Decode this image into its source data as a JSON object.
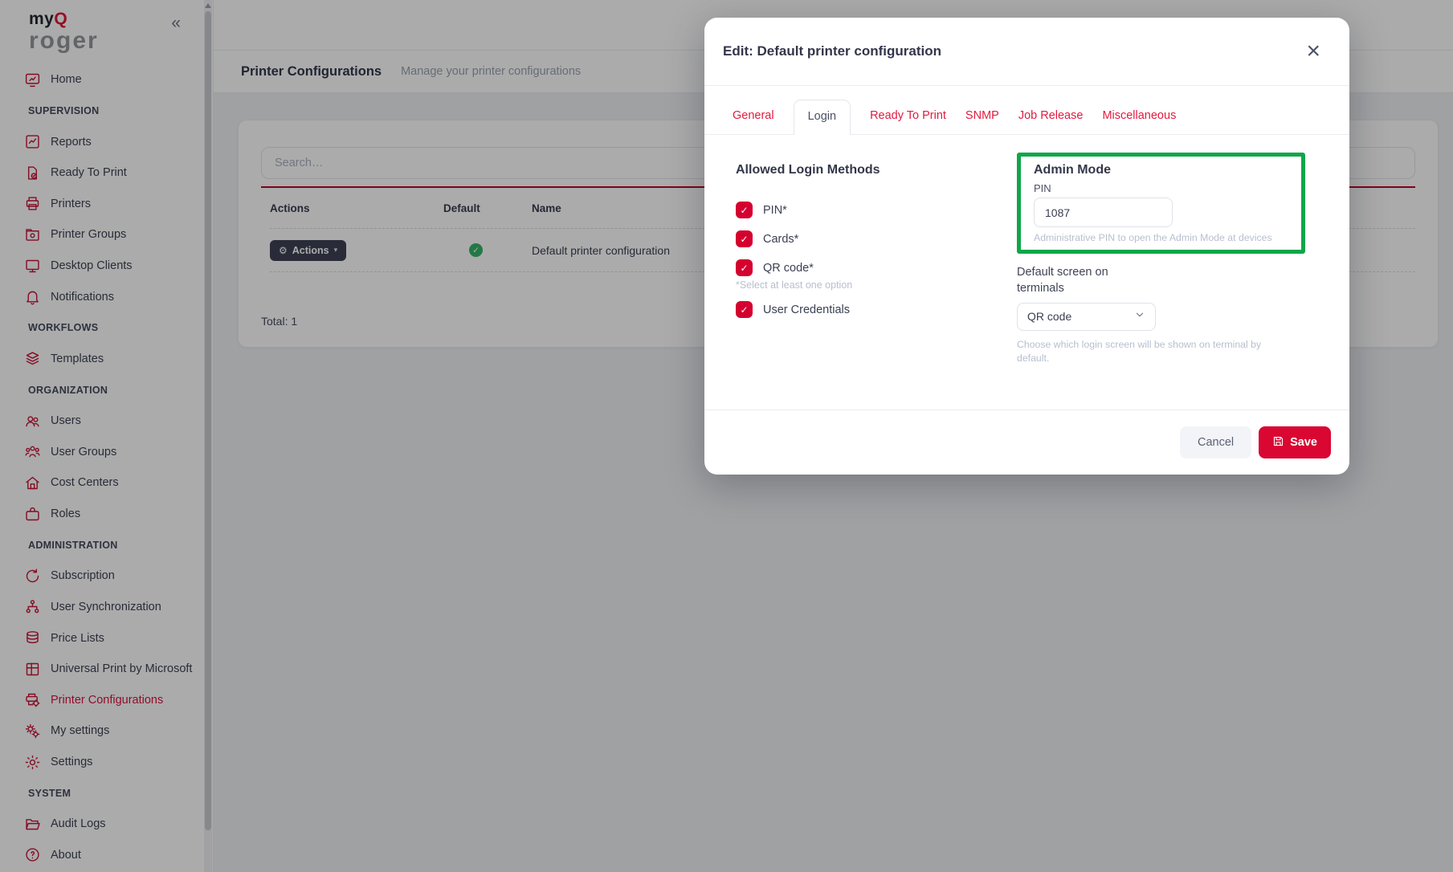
{
  "sidebar": {
    "logo_my": "my",
    "logo_q": "Q",
    "logo_roger": "roger",
    "collapse_icon": "«",
    "sections": [
      {
        "items": [
          {
            "label": "Home",
            "icon": "home"
          }
        ]
      },
      {
        "header": "SUPERVISION",
        "items": [
          {
            "label": "Reports",
            "icon": "reports"
          },
          {
            "label": "Ready To Print",
            "icon": "ready-to-print"
          },
          {
            "label": "Printers",
            "icon": "printers"
          },
          {
            "label": "Printer Groups",
            "icon": "printer-groups"
          },
          {
            "label": "Desktop Clients",
            "icon": "desktop-clients"
          },
          {
            "label": "Notifications",
            "icon": "notifications"
          }
        ]
      },
      {
        "header": "WORKFLOWS",
        "items": [
          {
            "label": "Templates",
            "icon": "templates"
          }
        ]
      },
      {
        "header": "ORGANIZATION",
        "items": [
          {
            "label": "Users",
            "icon": "users"
          },
          {
            "label": "User Groups",
            "icon": "user-groups"
          },
          {
            "label": "Cost Centers",
            "icon": "cost-centers"
          },
          {
            "label": "Roles",
            "icon": "roles"
          }
        ]
      },
      {
        "header": "ADMINISTRATION",
        "items": [
          {
            "label": "Subscription",
            "icon": "subscription"
          },
          {
            "label": "User Synchronization",
            "icon": "user-synchronization"
          },
          {
            "label": "Price Lists",
            "icon": "price-lists"
          },
          {
            "label": "Universal Print by Microsoft",
            "icon": "universal-print"
          },
          {
            "label": "Printer Configurations",
            "icon": "printer-configurations",
            "active": true
          },
          {
            "label": "My settings",
            "icon": "my-settings"
          },
          {
            "label": "Settings",
            "icon": "settings"
          }
        ]
      },
      {
        "header": "SYSTEM",
        "items": [
          {
            "label": "Audit Logs",
            "icon": "audit-logs"
          },
          {
            "label": "About",
            "icon": "about"
          }
        ]
      }
    ]
  },
  "page": {
    "title": "Printer Configurations",
    "subtitle": "Manage your printer configurations",
    "search_placeholder": "Search…",
    "table": {
      "columns": [
        "Actions",
        "Default",
        "Name"
      ],
      "rows": [
        {
          "actions_label": "Actions",
          "default": true,
          "name": "Default printer configuration"
        }
      ]
    },
    "total_label": "Total: 1"
  },
  "modal": {
    "title": "Edit: Default printer configuration",
    "close_icon": "×",
    "tabs": [
      {
        "label": "General"
      },
      {
        "label": "Login",
        "active": true
      },
      {
        "label": "Ready To Print"
      },
      {
        "label": "SNMP"
      },
      {
        "label": "Job Release"
      },
      {
        "label": "Miscellaneous"
      }
    ],
    "login": {
      "heading": "Allowed Login Methods",
      "options": [
        {
          "label": "PIN*",
          "checked": true
        },
        {
          "label": "Cards*",
          "checked": true
        },
        {
          "label": "QR code*",
          "checked": true
        },
        {
          "label": "User Credentials",
          "checked": true
        }
      ],
      "note": "*Select at least one option",
      "note_after": "QR code*"
    },
    "admin_mode": {
      "heading": "Admin Mode",
      "pin_label": "PIN",
      "pin_value": "1087",
      "helper": "Administrative PIN to open the Admin Mode at devices"
    },
    "default_screen": {
      "label": "Default screen on terminals",
      "value": "QR code",
      "helper": "Choose which login screen will be shown on terminal by default."
    },
    "footer": {
      "cancel_label": "Cancel",
      "save_label": "Save"
    }
  },
  "colors": {
    "brand_red": "#d90732",
    "tab_red": "#e41a3f",
    "checkbox_red": "#d4012f",
    "highlight_green": "#10a64a",
    "row_check_green": "#36b368",
    "actions_pill_dark": "#3e4154"
  }
}
